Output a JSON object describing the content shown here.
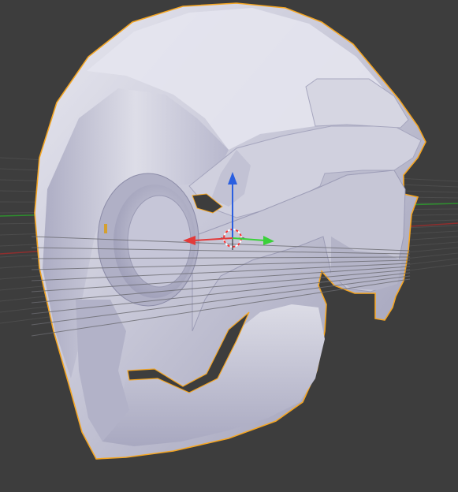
{
  "viewport": {
    "background": "#3d3d3d",
    "grid_color": "#4a4a4a",
    "x_axis_color": "#8f2e2e",
    "y_axis_color": "#2e8f2e"
  },
  "mesh": {
    "name": "helmet",
    "state": "selected",
    "base_color": "#c4c4d4",
    "highlight_color": "#e6e6ee",
    "shadow_color": "#8e8ea6",
    "outline_color": "#f5a623"
  },
  "gizmo": {
    "mode": "translate",
    "x_color": "#e23a3a",
    "y_color": "#3ad13a",
    "z_color": "#2a5fe0"
  },
  "cursor_3d": {
    "ring_color_a": "#ff3030",
    "ring_color_b": "#ffffff"
  }
}
